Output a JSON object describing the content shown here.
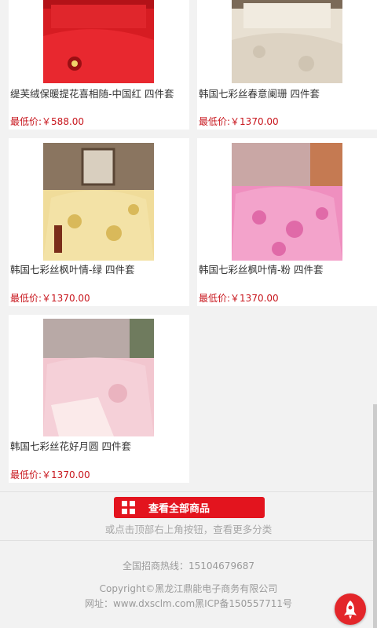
{
  "products": [
    {
      "title": "缇芙绒保暖提花喜相随-中国红 四件套",
      "price": "最低价:￥588.00",
      "image": "red-bedding-set-photo"
    },
    {
      "title": "韩国七彩丝春意阑珊 四件套",
      "price": "最低价:￥1370.00",
      "image": "cream-bedding-set-photo"
    },
    {
      "title": "韩国七彩丝枫叶情-绿 四件套",
      "price": "最低价:￥1370.00",
      "image": "yellow-bedding-set-photo"
    },
    {
      "title": "韩国七彩丝枫叶情-粉 四件套",
      "price": "最低价:￥1370.00",
      "image": "pink-leaf-bedding-set-photo"
    },
    {
      "title": "韩国七彩丝花好月圆 四件套",
      "price": "最低价:￥1370.00",
      "image": "pink-bedding-set-photo"
    }
  ],
  "view_all_label": "查看全部商品",
  "hint": "或点击顶部右上角按钮，查看更多分类",
  "footer": {
    "hotline": "全国招商热线：15104679687",
    "copyright": "Copyright©黑龙江鼎能电子商务有限公司",
    "site": "网址：www.dxsclm.com黑ICP备150557711号"
  },
  "colors": {
    "accent": "#e3141e",
    "price": "#c8161d"
  },
  "icons": {
    "view_all": "grid-icon",
    "back_to_top": "rocket-icon"
  }
}
